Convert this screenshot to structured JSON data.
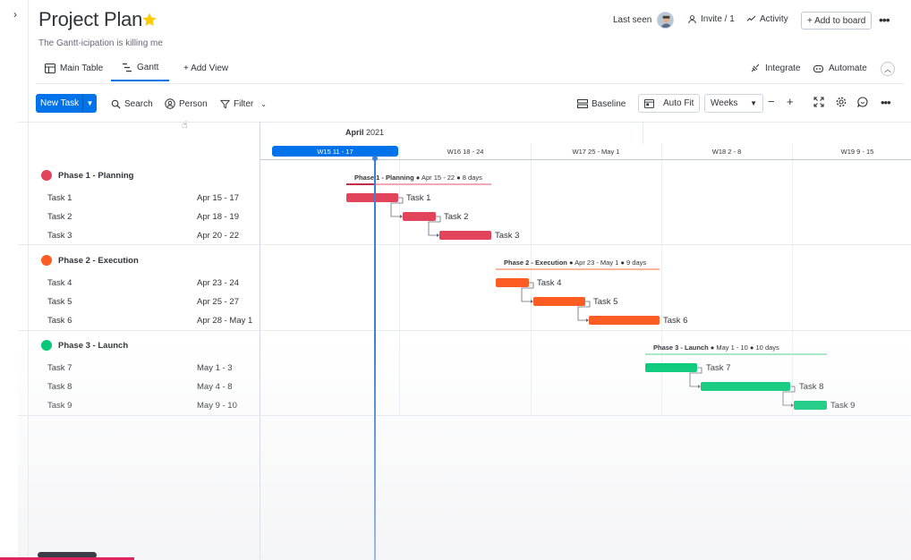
{
  "header": {
    "title": "Project Plan",
    "subtitle": "The Gantt-icipation is killing me",
    "last_seen": "Last seen",
    "invite": "Invite / 1",
    "activity": "Activity",
    "add_to_board": "+ Add to board"
  },
  "views": {
    "main_table": "Main Table",
    "gantt": "Gantt",
    "add_view": "+ Add View",
    "integrate": "Integrate",
    "automate": "Automate"
  },
  "toolbar": {
    "new_task": "New Task",
    "search": "Search",
    "person": "Person",
    "filter": "Filter",
    "baseline": "Baseline",
    "auto_fit": "Auto Fit",
    "zoom": "Weeks",
    "zoom_out": "−",
    "zoom_in": "+"
  },
  "timeline": {
    "month": "April",
    "year": "2021",
    "weeks": [
      "W15  11 - 17",
      "W16  18 - 24",
      "W17  25 - May 1",
      "W18  2 - 8",
      "W19  9 - 15"
    ]
  },
  "groups": [
    {
      "name": "Phase 1 - Planning",
      "color": "#e2445c",
      "summary_name": "Phase 1 - Planning",
      "summary_detail": " ● Apr 15 - 22 ● 8 days",
      "tasks": [
        {
          "name": "Task 1",
          "dates": "Apr 15 - 17"
        },
        {
          "name": "Task 2",
          "dates": "Apr 18 - 19"
        },
        {
          "name": "Task 3",
          "dates": "Apr 20 - 22"
        }
      ]
    },
    {
      "name": "Phase 2 - Execution",
      "color": "#fd5c22",
      "summary_name": "Phase 2 - Execution",
      "summary_detail": " ● Apr 23 - May 1 ● 9 days",
      "tasks": [
        {
          "name": "Task 4",
          "dates": "Apr 23 - 24"
        },
        {
          "name": "Task 5",
          "dates": "Apr 25 - 27"
        },
        {
          "name": "Task 6",
          "dates": "Apr 28 - May 1"
        }
      ]
    },
    {
      "name": "Phase 3 - Launch",
      "color": "#00c875",
      "summary_name": "Phase 3 - Launch",
      "summary_detail": " ● May 1 - 10 ● 10 days",
      "tasks": [
        {
          "name": "Task 7",
          "dates": "May 1 - 3"
        },
        {
          "name": "Task 8",
          "dates": "May 4 - 8"
        },
        {
          "name": "Task 9",
          "dates": "May 9 - 10"
        }
      ]
    }
  ],
  "icons": {
    "rail_toggle": "chevron-right-icon",
    "star": "star-icon",
    "cursor": "hand-cursor-icon"
  },
  "colors": {
    "accent": "#0073ea",
    "today_line": "#3b82d6"
  }
}
